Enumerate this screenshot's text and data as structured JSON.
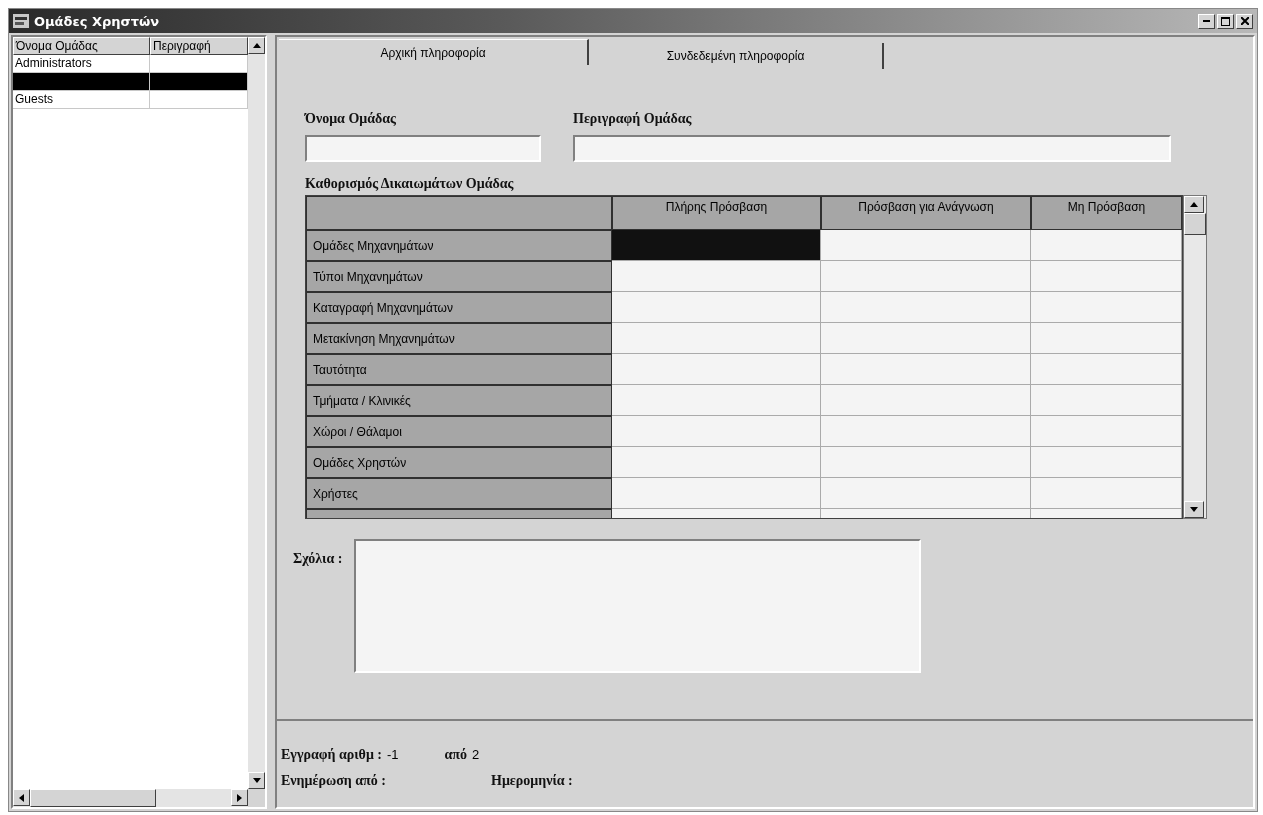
{
  "window": {
    "title": "Ομάδες Χρηστών"
  },
  "groups": {
    "columns": [
      "Όνομα Ομάδας",
      "Περιγραφή"
    ],
    "rows": [
      {
        "name": "Administrators",
        "selected": false
      },
      {
        "selected": true
      },
      {
        "name": "Guests",
        "selected": false
      }
    ]
  },
  "tabs": [
    {
      "label": "Αρχική πληροφορία",
      "selected": true
    },
    {
      "label": "Συνδεδεμένη πληροφορία",
      "selected": false
    }
  ],
  "form": {
    "name_label": "Όνομα Ομάδας",
    "description_label": "Περιγραφή Ομάδας"
  },
  "permissions": {
    "title": "Καθορισμός Δικαιωμάτων Ομάδας",
    "columns": [
      "Πλήρης Πρόσβαση",
      "Πρόσβαση για Ανάγνωση",
      "Μη Πρόσβαση"
    ],
    "rows": [
      {
        "label": "Ομάδες Μηχανημάτων",
        "cells": [
          {
            "selected": true
          },
          {
            "selected": false
          },
          {
            "selected": false
          }
        ]
      },
      {
        "label": "Τύποι Μηχανημάτων",
        "cells": [
          {
            "selected": false
          },
          {
            "selected": false
          },
          {
            "selected": false
          }
        ]
      },
      {
        "label": "Καταγραφή Μηχανημάτων",
        "cells": [
          {
            "selected": false
          },
          {
            "selected": false
          },
          {
            "selected": false
          }
        ]
      },
      {
        "label": "Μετακίνηση Μηχανημάτων",
        "cells": [
          {
            "selected": false
          },
          {
            "selected": false
          },
          {
            "selected": false
          }
        ]
      },
      {
        "label": "Ταυτότητα",
        "cells": [
          {
            "selected": false
          },
          {
            "selected": false
          },
          {
            "selected": false
          }
        ]
      },
      {
        "label": "Τμήματα / Κλινικές",
        "cells": [
          {
            "selected": false
          },
          {
            "selected": false
          },
          {
            "selected": false
          }
        ]
      },
      {
        "label": "Χώροι / Θάλαμοι",
        "cells": [
          {
            "selected": false
          },
          {
            "selected": false
          },
          {
            "selected": false
          }
        ]
      },
      {
        "label": "Ομάδες Χρηστών",
        "cells": [
          {
            "selected": false
          },
          {
            "selected": false
          },
          {
            "selected": false
          }
        ]
      },
      {
        "label": "Χρήστες",
        "cells": [
          {
            "selected": false
          },
          {
            "selected": false
          },
          {
            "selected": false
          }
        ]
      },
      {
        "cells": [
          {
            "selected": false
          },
          {
            "selected": false
          },
          {
            "selected": false
          }
        ]
      }
    ]
  },
  "comments": {
    "label": "Σχόλια :"
  },
  "footer": {
    "record_label": "Εγγραφή αριθμ :",
    "record_value": "-1",
    "of_label": "από",
    "of_value": "2",
    "updated_by_label": "Ενημέρωση από :",
    "date_label": "Ημερομηνία :"
  }
}
